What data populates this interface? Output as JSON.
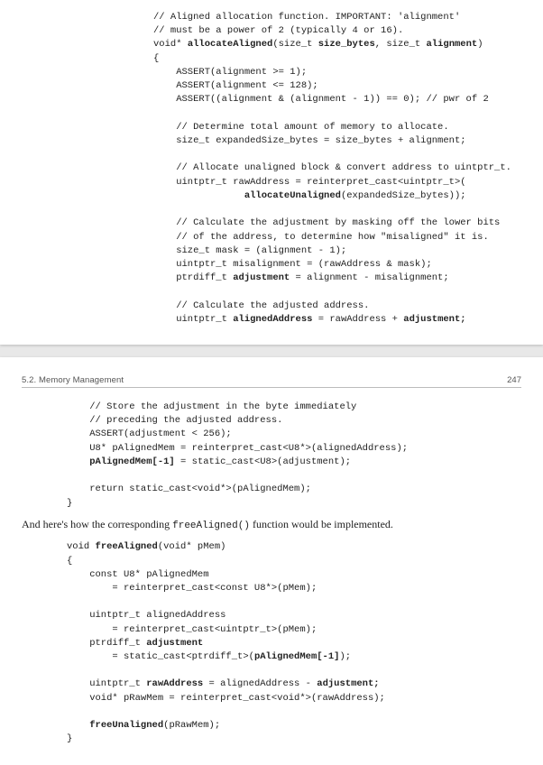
{
  "page1": {
    "code": "// Aligned allocation function. IMPORTANT: 'alignment'\n// must be a power of 2 (typically 4 or 16).\nvoid* <b>allocateAligned</b>(size_t <b>size_bytes</b>, size_t <b>alignment</b>)\n{\n    ASSERT(alignment >= 1);\n    ASSERT(alignment <= 128);\n    ASSERT((alignment & (alignment - 1)) == 0); // pwr of 2\n\n    // Determine total amount of memory to allocate.\n    size_t expandedSize_bytes = size_bytes + alignment;\n\n    // Allocate unaligned block & convert address to uintptr_t.\n    uintptr_t rawAddress = reinterpret_cast<uintptr_t>(\n                <b>allocateUnaligned</b>(expandedSize_bytes));\n\n    // Calculate the adjustment by masking off the lower bits\n    // of the address, to determine how \"misaligned\" it is.\n    size_t mask = (alignment - 1);\n    uintptr_t misalignment = (rawAddress & mask);\n    ptrdiff_t <b>adjustment</b> = alignment - misalignment;\n\n    // Calculate the adjusted address.\n    uintptr_t <b>alignedAddress</b> = rawAddress + <b>adjustment;</b>"
  },
  "page2": {
    "section_header": "5.2. Memory Management",
    "page_number": "247",
    "code_block_1": "    // Store the adjustment in the byte immediately\n    // preceding the adjusted address.\n    ASSERT(adjustment < 256);\n    U8* pAlignedMem = reinterpret_cast<U8*>(alignedAddress);\n    <b>pAlignedMem[-1]</b> = static_cast<U8>(adjustment);\n\n    return static_cast<void*>(pAlignedMem);\n}",
    "paragraph_1_pre": "And here's how the corresponding ",
    "paragraph_1_code": "freeAligned()",
    "paragraph_1_post": " function would be implemented.",
    "code_block_2": "void <b>freeAligned</b>(void* pMem)\n{\n    const U8* pAlignedMem\n        = reinterpret_cast<const U8*>(pMem);\n\n    uintptr_t alignedAddress\n        = reinterpret_cast<uintptr_t>(pMem);\n    ptrdiff_t <b>adjustment</b>\n        = static_cast<ptrdiff_t>(<b>pAlignedMem[-1]</b>);\n\n    uintptr_t <b>rawAddress</b> = alignedAddress - <b>adjustment;</b>\n    void* pRawMem = reinterpret_cast<void*>(rawAddress);\n\n    <b>freeUnaligned</b>(pRawMem);\n}"
  }
}
